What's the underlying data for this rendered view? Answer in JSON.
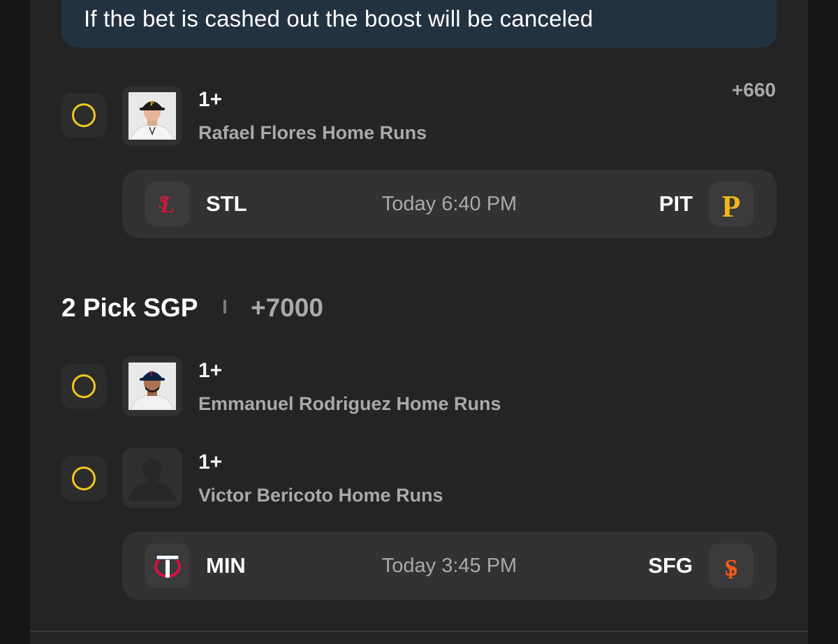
{
  "banner": {
    "text": "If the bet is cashed out the boost will be canceled"
  },
  "single_pick": {
    "odds": "+660",
    "leg": {
      "threshold": "1+",
      "prop": "Rafael Flores Home Runs",
      "avatar": "pirates-player-headshot"
    },
    "game": {
      "away": "STL",
      "time": "Today 6:40 PM",
      "home": "PIT",
      "away_logo": "cardinals-logo-icon",
      "home_logo": "pirates-logo-icon"
    }
  },
  "sgp": {
    "title": "2 Pick SGP",
    "odds": "+7000",
    "legs": [
      {
        "threshold": "1+",
        "prop": "Emmanuel Rodriguez Home Runs",
        "avatar": "twins-player-headshot"
      },
      {
        "threshold": "1+",
        "prop": "Victor Bericoto Home Runs",
        "avatar": "placeholder-silhouette"
      }
    ],
    "game": {
      "away": "MIN",
      "time": "Today 3:45 PM",
      "home": "SFG",
      "away_logo": "twins-logo-icon",
      "home_logo": "giants-logo-icon"
    }
  },
  "colors": {
    "accent": "#f2c81e",
    "banner_bg": "#233240",
    "panel_bg": "#242424",
    "muted_text": "#a9a9a9"
  }
}
